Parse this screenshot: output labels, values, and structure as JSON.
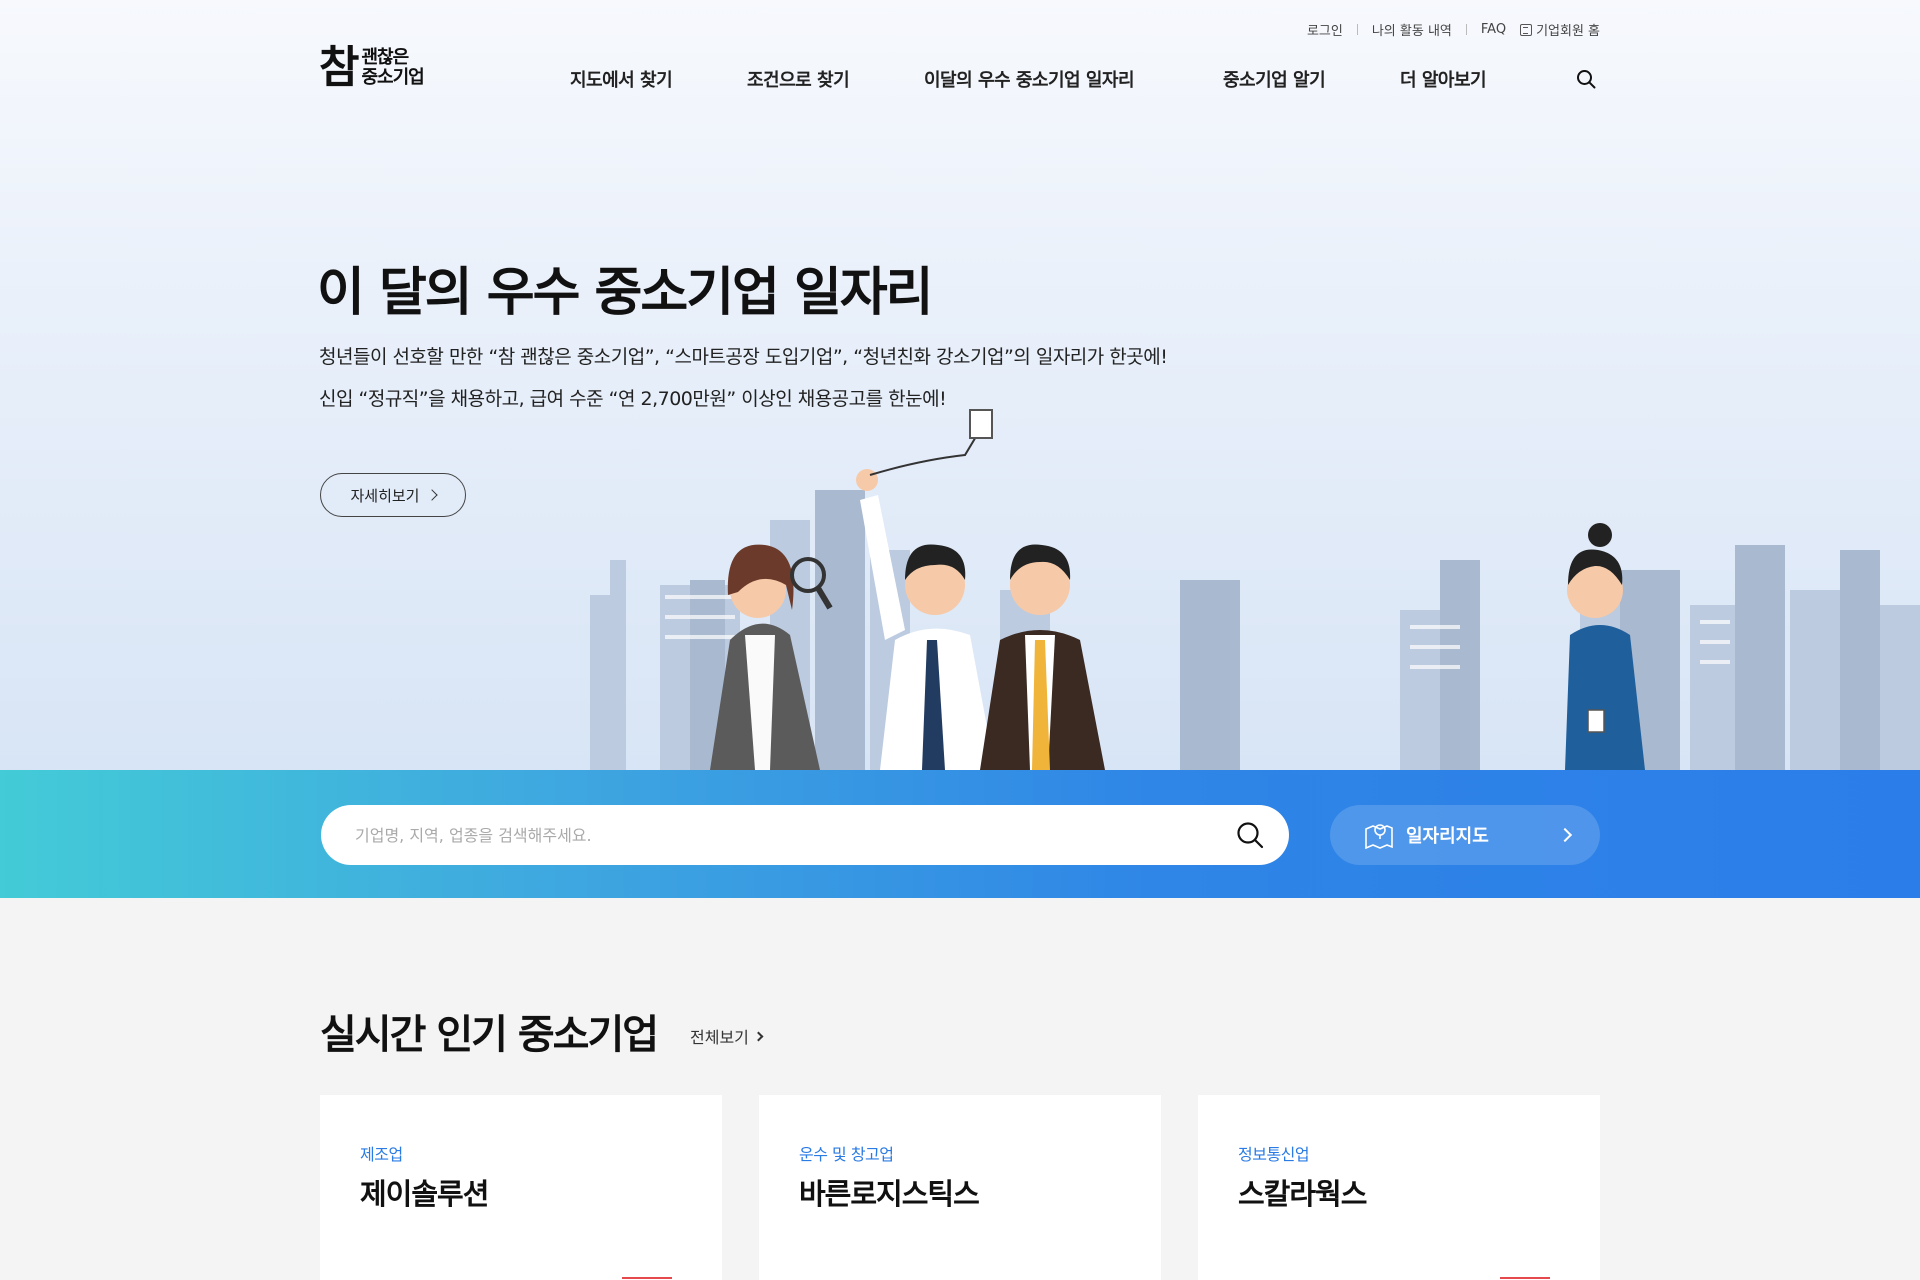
{
  "utility": {
    "login": "로그인",
    "activity": "나의 활동 내역",
    "faq": "FAQ",
    "biz_home": "기업회원 홈"
  },
  "logo": {
    "big": "참",
    "line1": "괜찮은",
    "line2": "중소기업"
  },
  "nav": {
    "items": [
      {
        "label": "지도에서 찾기"
      },
      {
        "label": "조건으로 찾기"
      },
      {
        "label": "이달의 우수 중소기업 일자리"
      },
      {
        "label": "중소기업 알기"
      },
      {
        "label": "더 알아보기"
      }
    ],
    "search_icon": "search-icon"
  },
  "hero": {
    "title": "이 달의 우수 중소기업 일자리",
    "desc_line1": "청년들이 선호할 만한 “참 괜찮은 중소기업”, “스마트공장 도입기업”, “청년친화 강소기업”의 일자리가 한곳에!",
    "desc_line2": "신입 “정규직”을 채용하고, 급여 수준 “연 2,700만원” 이상인 채용공고를 한눈에!",
    "more_label": "자세히보기"
  },
  "search": {
    "placeholder": "기업명, 지역, 업종을 검색해주세요.",
    "map_label": "일자리지도"
  },
  "popular": {
    "title": "실시간 인기 중소기업",
    "view_all": "전체보기",
    "cards": [
      {
        "category": "제조업",
        "name": "제이솔루션"
      },
      {
        "category": "운수 및 창고업",
        "name": "바른로지스틱스"
      },
      {
        "category": "정보통신업",
        "name": "스칼라웍스"
      }
    ]
  },
  "colors": {
    "accent_blue": "#2a7be4",
    "band_start": "#43cbd7",
    "band_end": "#2b7de9",
    "tag_red": "#e5484d"
  }
}
